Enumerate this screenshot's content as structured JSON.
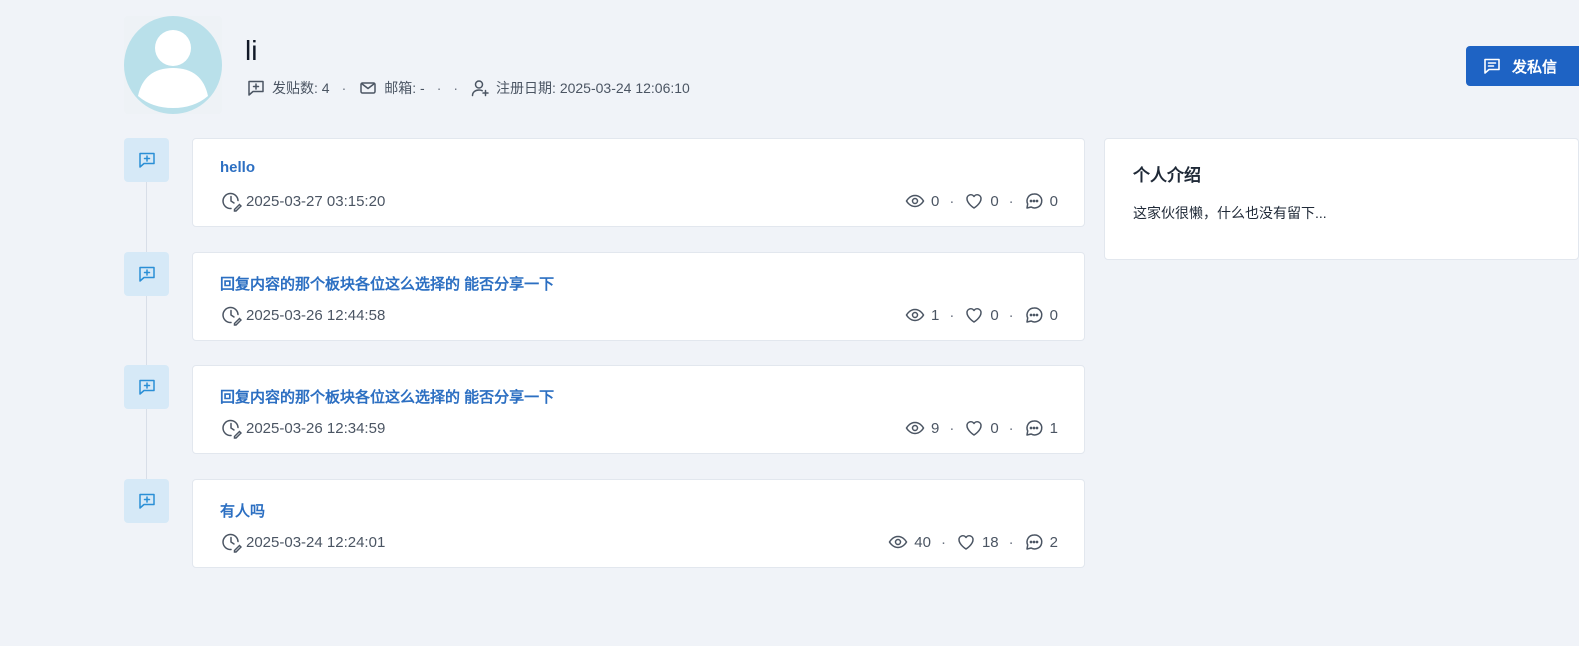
{
  "profile": {
    "username": "li",
    "post_count_label": "发贴数: 4",
    "email_label": "邮箱: -",
    "extra_sep": "·",
    "register_label": "注册日期: 2025-03-24 12:06:10",
    "avatar_icon": "user-avatar",
    "avatar_color": "#b9e0ea"
  },
  "actions": {
    "message_button_label": "发私信",
    "accent_color": "#1e63c4"
  },
  "posts": [
    {
      "title": "hello",
      "date": "2025-03-27 03:15:20",
      "views": "0",
      "likes": "0",
      "comments": "0"
    },
    {
      "title": "回复内容的那个板块各位这么选择的 能否分享一下",
      "date": "2025-03-26 12:44:58",
      "views": "1",
      "likes": "0",
      "comments": "0"
    },
    {
      "title": "回复内容的那个板块各位这么选择的 能否分享一下",
      "date": "2025-03-26 12:34:59",
      "views": "9",
      "likes": "0",
      "comments": "1"
    },
    {
      "title": "有人吗",
      "date": "2025-03-24 12:24:01",
      "views": "40",
      "likes": "18",
      "comments": "2"
    }
  ],
  "stats_separator": "·",
  "intro": {
    "title": "个人介绍",
    "text": "这家伙很懒，什么也没有留下..."
  }
}
